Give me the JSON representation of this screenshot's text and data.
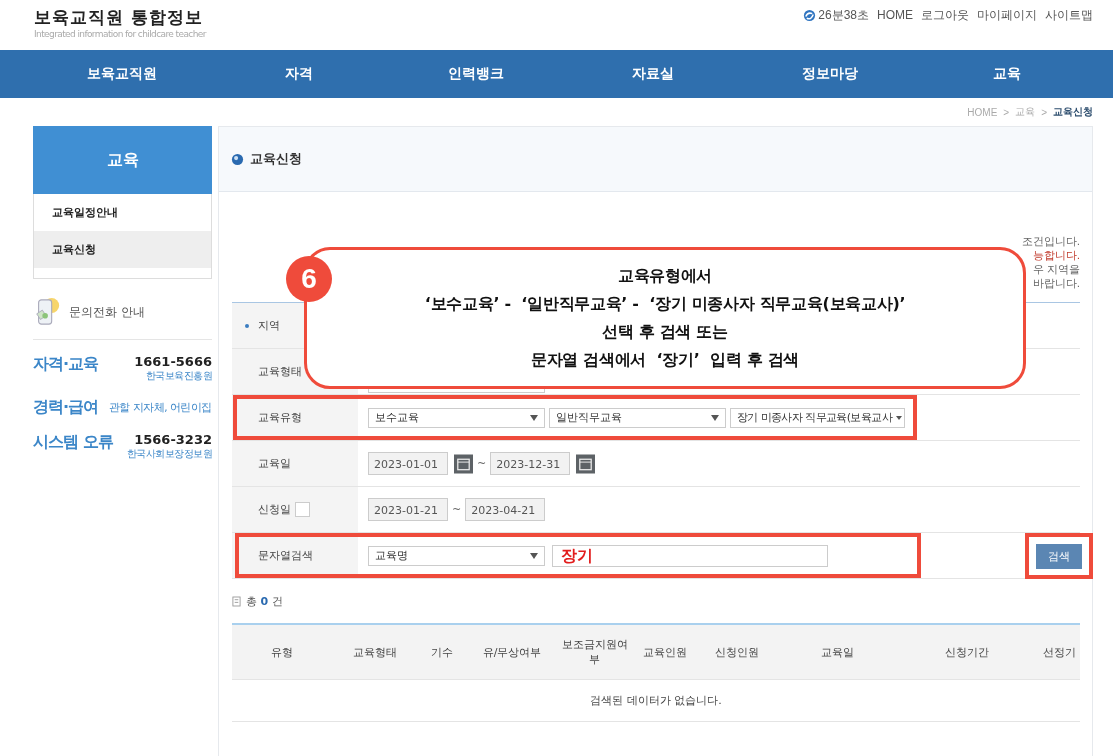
{
  "header": {
    "logo_title": "보육교직원 통합정보",
    "logo_subtitle": "Integrated information for childcare teacher",
    "session_timer": "26분38초",
    "links": [
      "HOME",
      "로그아웃",
      "마이페이지",
      "사이트맵"
    ]
  },
  "nav": [
    "보육교직원",
    "자격",
    "인력뱅크",
    "자료실",
    "정보마당",
    "교육"
  ],
  "breadcrumb_separator": ">",
  "breadcrumb": [
    {
      "label": "HOME",
      "selected": false
    },
    {
      "label": "교육",
      "selected": false
    },
    {
      "label": "교육신청",
      "selected": true
    }
  ],
  "sidebar": {
    "title": "교육",
    "items": [
      {
        "label": "교육일정안내",
        "selected": false
      },
      {
        "label": "교육신청",
        "selected": true
      }
    ],
    "contact_title": "문의전화 안내",
    "contacts": [
      {
        "category": "자격·교육",
        "phone": "1661-5666",
        "note": "한국보육진흥원"
      },
      {
        "category": "경력·급여",
        "note": "관할 지자체, 어린이집"
      },
      {
        "category": "시스템 오류",
        "phone": "1566-3232",
        "note": "한국사회보장정보원"
      }
    ]
  },
  "page_title": "교육신청",
  "notice_fragments": [
    {
      "text": "조건입니다.",
      "emphasis": false
    },
    {
      "text": "능합니다.",
      "emphasis": true
    },
    {
      "text": "우 지역을",
      "emphasis": false
    },
    {
      "text": "바랍니다.",
      "emphasis": false
    }
  ],
  "form": {
    "rows": [
      {
        "label": "지역",
        "kind": "required",
        "highlighted": false
      },
      {
        "label": "교육형태",
        "kind": "blank_select",
        "highlighted": false
      },
      {
        "label": "교육유형",
        "kind": "selects",
        "highlighted": true,
        "fields": [
          {
            "value": "보수교육"
          },
          {
            "value": "일반직무교육"
          },
          {
            "value": "장기 미종사자 직무교육(보육교사"
          }
        ]
      },
      {
        "label": "교육일",
        "kind": "date_range",
        "highlighted": false,
        "checkbox": false,
        "calendar": true,
        "separator": "~",
        "from": "2023-01-01",
        "to": "2023-12-31"
      },
      {
        "label": "신청일",
        "kind": "date_range",
        "highlighted": false,
        "checkbox": true,
        "checked": false,
        "calendar": false,
        "separator": "~",
        "from": "2023-01-21",
        "to": "2023-04-21"
      },
      {
        "label": "문자열검색",
        "kind": "text_search",
        "highlighted": true,
        "select": "교육명",
        "value": "장기"
      }
    ],
    "search_button": {
      "label": "검색",
      "highlighted": true
    }
  },
  "callout": {
    "number": "6",
    "lines": [
      "교육유형에서",
      "‘보수교육’ -  ‘일반직무교육’ -  ‘장기 미종사자 직무교육(보육교사)’",
      "선택 후 검색 또는",
      "문자열 검색에서  ‘장기’  입력 후 검색"
    ]
  },
  "result": {
    "prefix": "총",
    "count": "0",
    "suffix": "건"
  },
  "table": {
    "columns": [
      "유형",
      "교육형태",
      "기수",
      "유/무상여부",
      "보조금지원여부",
      "교육인원",
      "신청인원",
      "교육일",
      "신청기간",
      "선정기"
    ],
    "empty_message": "검색된 데이터가 없습니다."
  }
}
